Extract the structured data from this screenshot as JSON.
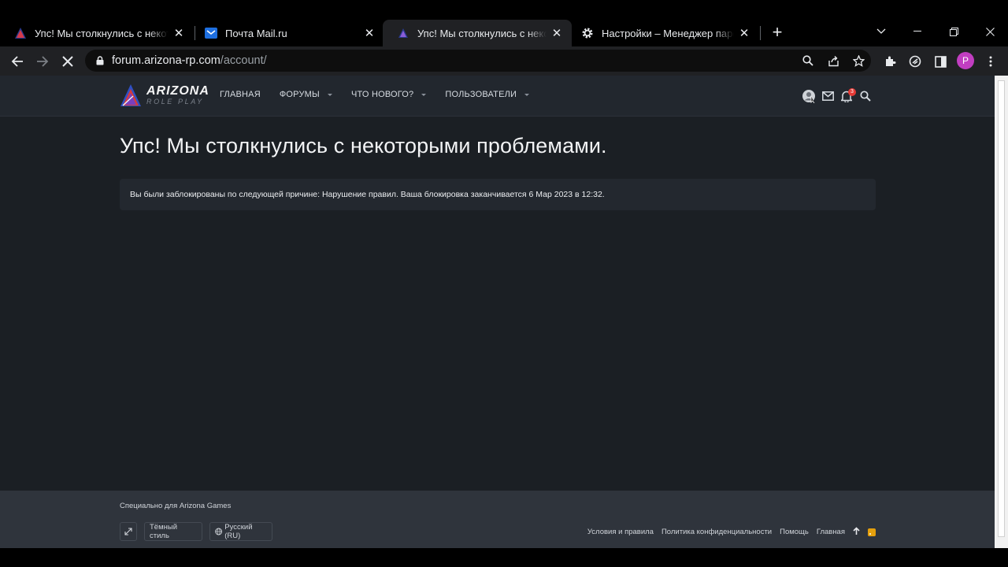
{
  "browser": {
    "tabs": [
      {
        "title": "Упс! Мы столкнулись с некоторыми проблемами",
        "icon": "arizona-logo-icon",
        "active": false
      },
      {
        "title": "Почта Mail.ru",
        "icon": "mail-icon",
        "active": false
      },
      {
        "title": "Упс! Мы столкнулись с некоторыми проблемами",
        "icon": "arizona-logo-icon",
        "active": true
      },
      {
        "title": "Настройки – Менеджер паролей",
        "icon": "gear-icon",
        "active": false
      }
    ],
    "url_host": "forum.arizona-rp.com",
    "url_path": "/account/",
    "profile_initial": "P",
    "colors": {
      "tabbar": "#000000",
      "toolbar": "#202124",
      "profile": "#c13ec1"
    }
  },
  "site": {
    "logo_main": "ARIZONA",
    "logo_sub": "ROLE PLAY",
    "nav": [
      {
        "label": "ГЛАВНАЯ",
        "dropdown": false
      },
      {
        "label": "ФОРУМЫ",
        "dropdown": true
      },
      {
        "label": "ЧТО НОВОГО?",
        "dropdown": true
      },
      {
        "label": "ПОЛЬЗОВАТЕЛИ",
        "dropdown": true
      }
    ],
    "notification_count": "3",
    "page_title": "Упс! Мы столкнулись с некоторыми проблемами.",
    "notice": "Вы были заблокированы по следующей причине: Нарушение правил. Ваша блокировка заканчивается 6 Мар 2023 в 12:32.",
    "footer": {
      "credit": "Специально для Arizona Games",
      "style_button": "Тёмный стиль",
      "language_button": "Русский (RU)",
      "links": [
        "Условия и правила",
        "Политика конфиденциальности",
        "Помощь",
        "Главная"
      ]
    },
    "colors": {
      "background": "#1b1f24",
      "header": "#22272e",
      "footer": "#2f343c",
      "badge": "#e53935",
      "rss": "#e5a00d"
    }
  }
}
